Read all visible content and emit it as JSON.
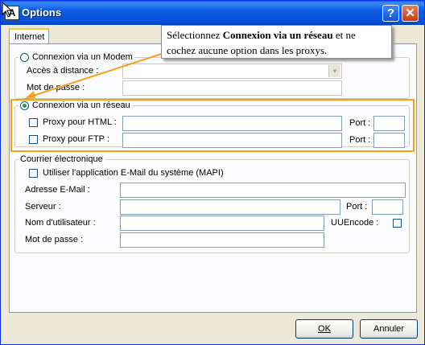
{
  "window": {
    "title": "Options",
    "help_glyph": "?",
    "close_glyph": "✕",
    "icon_glyph": "A"
  },
  "tab": {
    "label": "Internet"
  },
  "modem": {
    "legend": "Connexion via un Modem",
    "remote_label": "Accès à distance :",
    "password_label": "Mot de passe :"
  },
  "network": {
    "legend": "Connexion via un réseau",
    "proxy_html_label": "Proxy pour HTML :",
    "proxy_ftp_label": "Proxy pour FTP :",
    "port_label": "Port :"
  },
  "mail": {
    "legend": "Courrier électronique",
    "mapi_label": "Utiliser l'application E-Mail du système (MAPI)",
    "email_label": "Adresse E-Mail :",
    "server_label": "Serveur :",
    "port_label": "Port :",
    "username_label": "Nom d'utilisateur :",
    "uuencode_label": "UUEncode :",
    "password_label": "Mot de passe :"
  },
  "callout": {
    "text_before": "Sélectionnez ",
    "text_bold": "Connexion via un réseau",
    "text_after": " et ne cochez aucune option dans les proxys."
  },
  "buttons": {
    "ok": "OK",
    "cancel": "Annuler"
  },
  "colors": {
    "highlight": "#f5a214",
    "title_bar": "#0450d7"
  }
}
